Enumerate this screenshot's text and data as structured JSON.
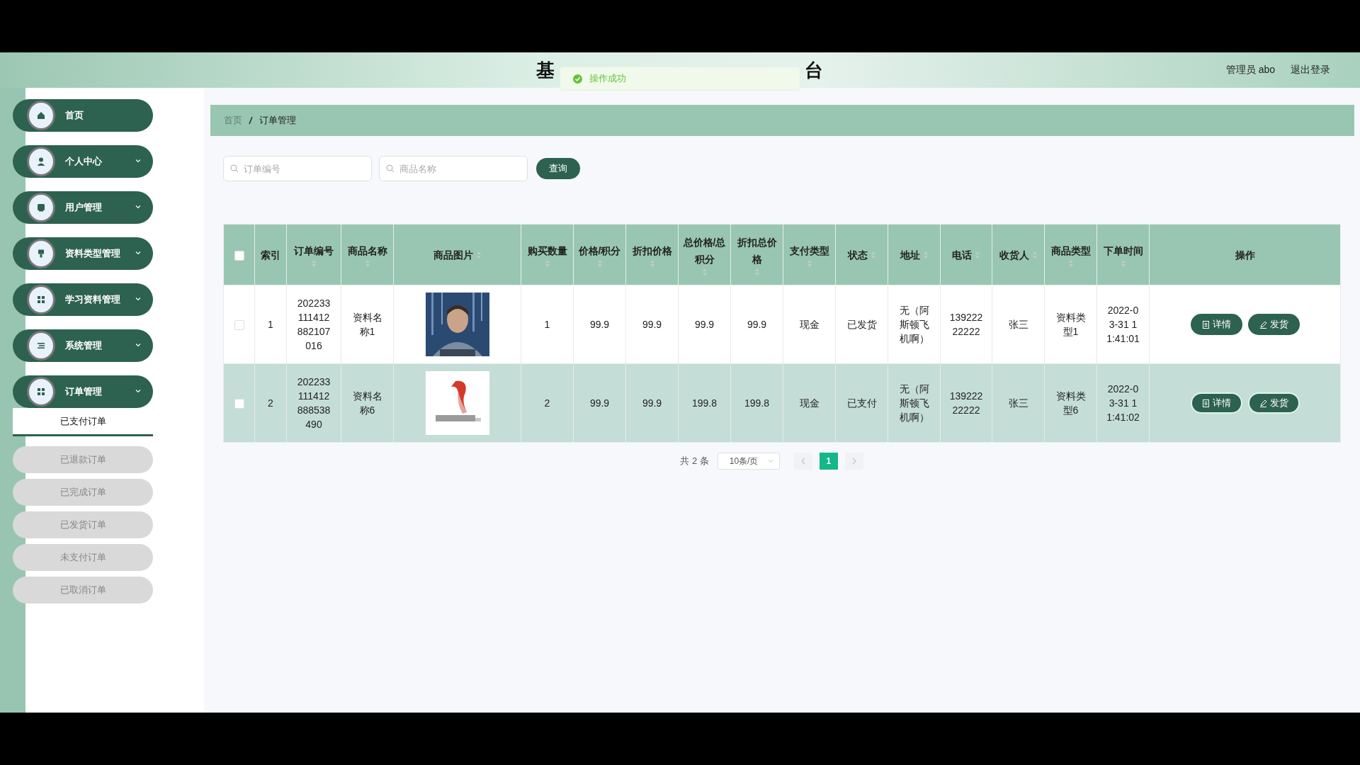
{
  "header": {
    "title_parts": [
      "基",
      "台"
    ],
    "user": "管理员 abo",
    "logout": "退出登录"
  },
  "toast": {
    "message": "操作成功",
    "kind": "success"
  },
  "sidebar": {
    "items": [
      {
        "label": "首页",
        "kind": "link"
      },
      {
        "label": "个人中心",
        "kind": "group"
      },
      {
        "label": "用户管理",
        "kind": "group"
      },
      {
        "label": "资料类型管理",
        "kind": "group"
      },
      {
        "label": "学习资料管理",
        "kind": "group"
      },
      {
        "label": "系统管理",
        "kind": "group"
      },
      {
        "label": "订单管理",
        "kind": "group",
        "children": [
          {
            "label": "已支付订单",
            "selected": true
          },
          {
            "label": "已退款订单",
            "selected": false
          },
          {
            "label": "已完成订单",
            "selected": false
          },
          {
            "label": "已发货订单",
            "selected": false
          },
          {
            "label": "未支付订单",
            "selected": false
          },
          {
            "label": "已取消订单",
            "selected": false
          }
        ]
      }
    ]
  },
  "breadcrumb": [
    "首页",
    "订单管理"
  ],
  "search": {
    "fields": [
      {
        "placeholder": "订单编号"
      },
      {
        "placeholder": "商品名称"
      }
    ],
    "button": "查询"
  },
  "table": {
    "all_checked": false,
    "columns": [
      {
        "label": "索引",
        "sortable": false
      },
      {
        "label": "订单编号",
        "sortable": true
      },
      {
        "label": "商品名称",
        "sortable": true
      },
      {
        "label": "商品图片",
        "sortable": true
      },
      {
        "label": "购买数量",
        "sortable": true
      },
      {
        "label": "价格/积分",
        "sortable": true
      },
      {
        "label": "折扣价格",
        "sortable": true
      },
      {
        "label": "总价格/总积分",
        "sortable": true
      },
      {
        "label": "折扣总价格",
        "sortable": true
      },
      {
        "label": "支付类型",
        "sortable": true
      },
      {
        "label": "状态",
        "sortable": true
      },
      {
        "label": "地址",
        "sortable": true
      },
      {
        "label": "电话",
        "sortable": true
      },
      {
        "label": "收货人",
        "sortable": true
      },
      {
        "label": "商品类型",
        "sortable": true
      },
      {
        "label": "下单时间",
        "sortable": true
      },
      {
        "label": "操作",
        "sortable": false
      }
    ],
    "rows": [
      {
        "checked": false,
        "highlighted": false,
        "cells": [
          "1",
          "202233111412882107016",
          "资料名称1",
          {
            "kind": "picture"
          },
          "1",
          "99.9",
          "99.9",
          "99.9",
          "99.9",
          "现金",
          "已发货",
          "无（阿斯顿飞机啊）",
          "13922222222",
          "张三",
          "资料类型1",
          "2022-03-31 11:41:01"
        ],
        "actions": [
          "详情",
          "发货"
        ]
      },
      {
        "checked": false,
        "highlighted": true,
        "cells": [
          "2",
          "202233111412888538490",
          "资料名称6",
          {
            "kind": "picture"
          },
          "2",
          "99.9",
          "99.9",
          "199.8",
          "199.8",
          "现金",
          "已支付",
          "无（阿斯顿飞机啊）",
          "13922222222",
          "张三",
          "资料类型6",
          "2022-03-31 11:41:02"
        ],
        "actions": [
          "详情",
          "发货"
        ]
      }
    ]
  },
  "pagination": {
    "total": "共 2 条",
    "page_size": "10条/页",
    "pages": [
      {
        "label": "1",
        "selected": true
      }
    ]
  }
}
